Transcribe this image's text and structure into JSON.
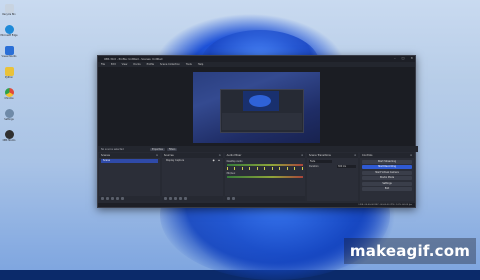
{
  "desktop": {
    "icons": [
      {
        "label": "Recycle Bin",
        "icon": "recycle-bin-icon",
        "color": "#c8d3e0"
      },
      {
        "label": "Microsoft Edge",
        "icon": "edge-icon",
        "color": "#1f8ad8"
      },
      {
        "label": "Visual Studio",
        "icon": "code-icon",
        "color": "#2a6fd6"
      },
      {
        "label": "Python",
        "icon": "python-icon",
        "color": "#e9c23a"
      },
      {
        "label": "Chrome",
        "icon": "chrome-icon",
        "color": "#e04a3a"
      },
      {
        "label": "Settings",
        "icon": "gear-icon",
        "color": "#6f8aa8"
      },
      {
        "label": "OBS Studio",
        "icon": "obs-icon",
        "color": "#303030"
      }
    ]
  },
  "window": {
    "title": "OBS 30.0 - Profile: Untitled - Scenes: Untitled",
    "controls": [
      "–",
      "□",
      "✕"
    ],
    "menu": [
      "File",
      "Edit",
      "View",
      "Docks",
      "Profile",
      "Scene Collection",
      "Tools",
      "Help"
    ],
    "source_bar": {
      "text": "No source selected",
      "properties": "Properties",
      "filters": "Filters"
    },
    "docks": {
      "scenes": {
        "title": "Scenes",
        "items": [
          "Scene"
        ]
      },
      "sources": {
        "title": "Sources",
        "items": [
          "Display Capture"
        ]
      },
      "mixer": {
        "title": "Audio Mixer",
        "channels": [
          "Desktop Audio",
          "Mic/Aux"
        ]
      },
      "transitions": {
        "title": "Scene Transitions",
        "type": "Fade",
        "duration_label": "Duration",
        "duration": "300 ms"
      },
      "controls": {
        "title": "Controls",
        "buttons": [
          "Start Streaming",
          "Start Recording",
          "Start Virtual Camera",
          "Studio Mode",
          "Settings",
          "Exit"
        ],
        "active_index": 1
      }
    },
    "status": "LIVE: 00:00:00   REC: 00:00:00   CPU: 2.0%, 60.00 fps"
  },
  "watermark": "makeagif.com"
}
